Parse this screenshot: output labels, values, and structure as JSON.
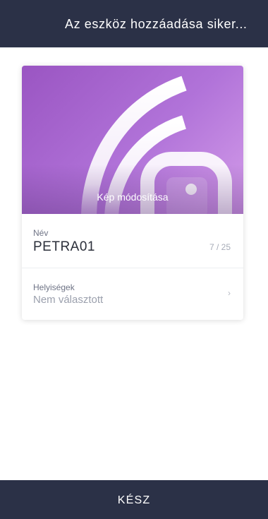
{
  "header": {
    "title": "Az eszköz hozzáadása siker..."
  },
  "device_card": {
    "photo_action": "Kép módosítása",
    "photo_icon": "wifi-signal-icon",
    "name_field": {
      "label": "Név",
      "value": "PETRA01",
      "counter": "7 / 25"
    },
    "rooms_field": {
      "label": "Helyiségek",
      "value": "Nem választott",
      "icon": "chevron-right-icon"
    }
  },
  "footer": {
    "done_label": "KÉSZ"
  },
  "colors": {
    "header_bg": "#2b3147",
    "footer_bg": "#2b3147",
    "photo_gradient_start": "#9a55c2",
    "photo_gradient_end": "#d39ce9"
  }
}
